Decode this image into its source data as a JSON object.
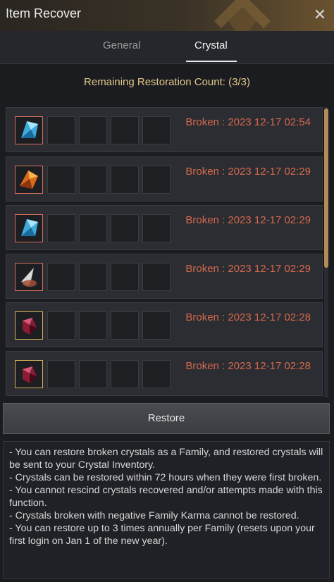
{
  "window": {
    "title": "Item Recover"
  },
  "tabs": [
    {
      "label": "General",
      "active": false
    },
    {
      "label": "Crystal",
      "active": true
    }
  ],
  "remaining": "Remaining Restoration Count: (3/3)",
  "items": [
    {
      "icon": "blue-crystal-icon",
      "border": "#d6705a",
      "broken": "Broken : 2023 12-17 02:54"
    },
    {
      "icon": "orange-crystal-icon",
      "border": "#d6705a",
      "broken": "Broken : 2023 12-17 02:29"
    },
    {
      "icon": "blue-crystal-icon",
      "border": "#d6705a",
      "broken": "Broken : 2023 12-17 02:29"
    },
    {
      "icon": "white-crystal-icon",
      "border": "#d6705a",
      "broken": "Broken : 2023 12-17 02:29"
    },
    {
      "icon": "red-crystal-icon",
      "border": "#d8b25a",
      "broken": "Broken : 2023 12-17 02:28"
    },
    {
      "icon": "red-crystal-icon",
      "border": "#d8b25a",
      "broken": "Broken : 2023 12-17 02:28"
    }
  ],
  "restore_label": "Restore",
  "notes": [
    "- You can restore broken crystals as a Family, and restored crystals will be sent to your Crystal Inventory.",
    "- Crystals can be restored within 72 hours when they were first broken.",
    "- You cannot rescind crystals recovered and/or attempts made with this function.",
    "- Crystals broken with negative Family Karma cannot be restored.",
    "- You can restore up to 3 times annually per Family (resets upon your first login on Jan 1 of the new year)."
  ],
  "colors": {
    "broken_text": "#d4694e",
    "accent": "#e0c888",
    "scroll": "#b08d57"
  }
}
